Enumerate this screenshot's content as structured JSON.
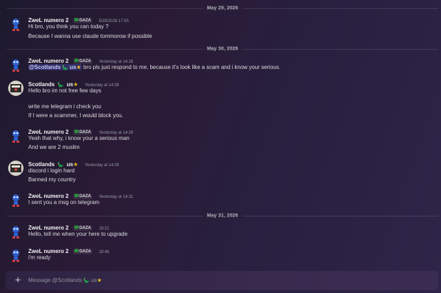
{
  "dividers": [
    "May 29, 2026",
    "May 30, 2026",
    "May 31, 2026"
  ],
  "authors": {
    "zwel": "ZweL numero 2",
    "scotlands": "Scotlands",
    "scotlands_suffix": "us"
  },
  "tag": "GAZA",
  "messages": [
    {
      "author": "ZweL numero 2",
      "time": "5/29/2026 17:55",
      "lines": [
        "Hi bro, you think you can today ?",
        "Because I wanna use claude tommorow if possible"
      ]
    },
    {
      "author": "ZweL numero 2",
      "time": "Yesterday at 14:28",
      "mention": "@Scotlands",
      "mention_suffix": "us",
      "lines": [
        "bro pls just respond to me, because it's look like a scam and i know your serious."
      ]
    },
    {
      "author": "Scotlands",
      "time": "Yesterday at 14:28",
      "lines": [
        "Hello bro im not free few days",
        "write me telegram i check you",
        "If I were a scammer, I would block you."
      ]
    },
    {
      "author": "ZweL numero 2",
      "time": "Yesterday at 14:29",
      "lines": [
        "Yeah that why, i know your a serious man",
        "And we are 2 muslim"
      ]
    },
    {
      "author": "Scotlands",
      "time": "Yesterday at 14:29",
      "lines": [
        "discord i login hard",
        "Banned my country"
      ]
    },
    {
      "author": "ZweL numero 2",
      "time": "Yesterday at 14:31",
      "lines": [
        "I sent you a msg on telegram"
      ]
    },
    {
      "author": "ZweL numero 2",
      "time": "19:21",
      "lines": [
        "Hello, tell me when your here to upgrade"
      ]
    },
    {
      "author": "ZweL numero 2",
      "time": "19:46",
      "lines": [
        "i'm ready"
      ]
    }
  ],
  "composer": {
    "placeholder": "Message @Scotlands",
    "placeholder_suffix": "us"
  },
  "icons": {
    "plus": "+",
    "star": "★",
    "dino": "🦕"
  },
  "colors": {
    "mention_bg": "#3a3f8a",
    "tag_flag": "#2b8a3e",
    "star": "#f5c518"
  }
}
